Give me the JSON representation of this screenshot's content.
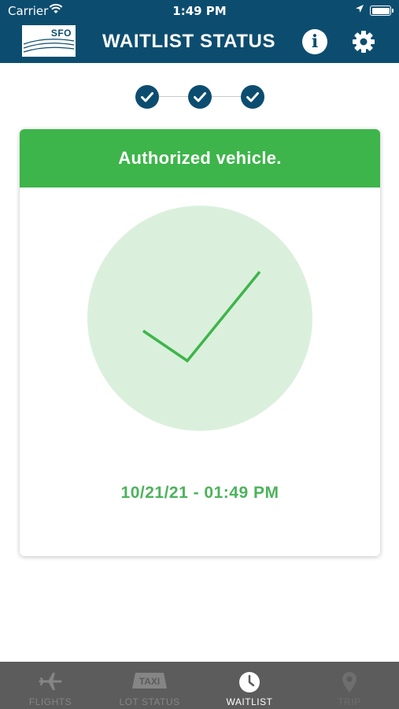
{
  "status_bar": {
    "carrier": "Carrier",
    "time": "1:49 PM"
  },
  "header": {
    "logo_text": "SFO",
    "title": "WAITLIST STATUS",
    "info_icon": "info-icon",
    "settings_icon": "gear-icon"
  },
  "stepper": {
    "steps_completed": 3,
    "steps_total": 3
  },
  "card": {
    "banner": "Authorized vehicle.",
    "status_icon": "checkmark-icon",
    "timestamp": "10/21/21 - 01:49 PM"
  },
  "tabs": [
    {
      "label": "FLIGHTS",
      "icon": "airplane-icon",
      "state": "inactive"
    },
    {
      "label": "LOT STATUS",
      "icon": "taxi-sign-icon",
      "icon_text": "TAXI",
      "state": "inactive"
    },
    {
      "label": "WAITLIST",
      "icon": "clock-icon",
      "state": "active"
    },
    {
      "label": "TRIP",
      "icon": "location-pin-icon",
      "state": "disabled"
    }
  ],
  "colors": {
    "brand": "#0c4d6f",
    "success": "#3db54a",
    "success_light": "#daf0dc",
    "timestamp": "#4cb35b",
    "tabbar": "#5c5c5c"
  }
}
